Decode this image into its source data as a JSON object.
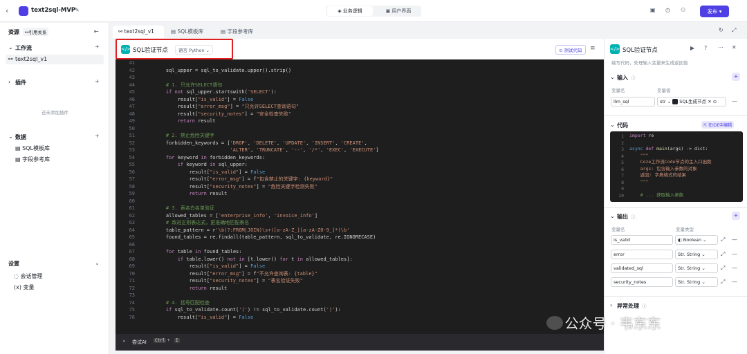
{
  "header": {
    "back_icon": "chevron-left",
    "project_title": "text2sql-MVP",
    "mode_tabs": [
      "业务逻辑",
      "用户界面"
    ],
    "publish_label": "发布"
  },
  "sidebar": {
    "resources_label": "资源",
    "references_label": "引用关系",
    "workflow_label": "工作流",
    "workflow_items": [
      "text2sql_v1"
    ],
    "plugins_label": "插件",
    "plugins_empty": "还未添加插件",
    "data_label": "数据",
    "data_items": [
      "SQL模板库",
      "字段参考库"
    ],
    "settings_label": "设置",
    "settings_items": [
      "会话管理",
      "变量"
    ]
  },
  "tabs": [
    "text2sql_v1",
    "SQL模板库",
    "字段参考库"
  ],
  "editor": {
    "title": "SQL验证节点",
    "language": "语言 Python",
    "test_label": "测试代码",
    "line_start": 41,
    "lines": [
      [],
      [
        [
          "v",
          "    sql_upper = sql_to_validate.upper().strip()"
        ]
      ],
      [],
      [
        [
          "cm",
          "    # 1. 只允许SELECT语句"
        ]
      ],
      [
        [
          "kw",
          "    if not "
        ],
        [
          "v",
          "sql_upper.startswith("
        ],
        [
          "str",
          "'SELECT'"
        ],
        [
          "v",
          "):"
        ]
      ],
      [
        [
          "v",
          "        result["
        ],
        [
          "str",
          "\"is_valid\""
        ],
        [
          "v",
          "] = "
        ],
        [
          "kw2",
          "False"
        ]
      ],
      [
        [
          "v",
          "        result["
        ],
        [
          "str",
          "\"error_msg\""
        ],
        [
          "v",
          "] = "
        ],
        [
          "str",
          "\"只允许SELECT查询语句\""
        ]
      ],
      [
        [
          "v",
          "        result["
        ],
        [
          "str",
          "\"security_notes\""
        ],
        [
          "v",
          "] = "
        ],
        [
          "str",
          "\"安全检查失败\""
        ]
      ],
      [
        [
          "kw",
          "        return "
        ],
        [
          "v",
          "result"
        ]
      ],
      [],
      [
        [
          "cm",
          "    # 2. 禁止危险关键字"
        ]
      ],
      [
        [
          "v",
          "    forbidden_keywords = ["
        ],
        [
          "str",
          "'DROP'"
        ],
        [
          "v",
          ", "
        ],
        [
          "str",
          "'DELETE'"
        ],
        [
          "v",
          ", "
        ],
        [
          "str",
          "'UPDATE'"
        ],
        [
          "v",
          ", "
        ],
        [
          "str",
          "'INSERT'"
        ],
        [
          "v",
          ", "
        ],
        [
          "str",
          "'CREATE'"
        ],
        [
          "v",
          ","
        ]
      ],
      [
        [
          "v",
          "                          "
        ],
        [
          "str",
          "'ALTER'"
        ],
        [
          "v",
          ", "
        ],
        [
          "str",
          "'TRUNCATE'"
        ],
        [
          "v",
          ", "
        ],
        [
          "str",
          "'--'"
        ],
        [
          "v",
          ", "
        ],
        [
          "str",
          "'/*'"
        ],
        [
          "v",
          ", "
        ],
        [
          "str",
          "'EXEC'"
        ],
        [
          "v",
          ", "
        ],
        [
          "str",
          "'EXECUTE'"
        ],
        [
          "v",
          "]"
        ]
      ],
      [
        [
          "kw",
          "    for "
        ],
        [
          "v",
          "keyword "
        ],
        [
          "kw",
          "in "
        ],
        [
          "v",
          "forbidden_keywords:"
        ]
      ],
      [
        [
          "kw",
          "        if "
        ],
        [
          "v",
          "keyword "
        ],
        [
          "kw",
          "in "
        ],
        [
          "v",
          "sql_upper:"
        ]
      ],
      [
        [
          "v",
          "            result["
        ],
        [
          "str",
          "\"is_valid\""
        ],
        [
          "v",
          "] = "
        ],
        [
          "kw2",
          "False"
        ]
      ],
      [
        [
          "v",
          "            result["
        ],
        [
          "str",
          "\"error_msg\""
        ],
        [
          "v",
          "] = f"
        ],
        [
          "str",
          "\"包含禁止的关键字: {keyword}\""
        ]
      ],
      [
        [
          "v",
          "            result["
        ],
        [
          "str",
          "\"security_notes\""
        ],
        [
          "v",
          "] = "
        ],
        [
          "str",
          "\"危险关键字检测失败\""
        ]
      ],
      [
        [
          "kw",
          "            return "
        ],
        [
          "v",
          "result"
        ]
      ],
      [],
      [
        [
          "cm",
          "    # 3. 表名白名单验证"
        ]
      ],
      [
        [
          "v",
          "    allowed_tables = ["
        ],
        [
          "str",
          "'enterprise_info'"
        ],
        [
          "v",
          ", "
        ],
        [
          "str",
          "'invoice_info'"
        ],
        [
          "v",
          "]"
        ]
      ],
      [
        [
          "cm",
          "    # 改进正则表达式，更准确地匹配表名"
        ]
      ],
      [
        [
          "v",
          "    table_pattern = r"
        ],
        [
          "str",
          "'\\b(?:FROM|JOIN)\\s+([a-zA-Z_][a-zA-Z0-9_]*)\\b'"
        ]
      ],
      [
        [
          "v",
          "    found_tables = re.findall(table_pattern, sql_to_validate, re.IGNORECASE)"
        ]
      ],
      [],
      [
        [
          "kw",
          "    for "
        ],
        [
          "v",
          "table "
        ],
        [
          "kw",
          "in "
        ],
        [
          "v",
          "found_tables:"
        ]
      ],
      [
        [
          "kw",
          "        if "
        ],
        [
          "v",
          "table.lower() "
        ],
        [
          "kw",
          "not in "
        ],
        [
          "v",
          "[t.lower() "
        ],
        [
          "kw",
          "for "
        ],
        [
          "v",
          "t "
        ],
        [
          "kw",
          "in "
        ],
        [
          "v",
          "allowed_tables]:"
        ]
      ],
      [
        [
          "v",
          "            result["
        ],
        [
          "str",
          "\"is_valid\""
        ],
        [
          "v",
          "] = "
        ],
        [
          "kw2",
          "False"
        ]
      ],
      [
        [
          "v",
          "            result["
        ],
        [
          "str",
          "\"error_msg\""
        ],
        [
          "v",
          "] = f"
        ],
        [
          "str",
          "\"不允许查询表: {table}\""
        ]
      ],
      [
        [
          "v",
          "            result["
        ],
        [
          "str",
          "\"security_notes\""
        ],
        [
          "v",
          "] = "
        ],
        [
          "str",
          "\"表名验证失败\""
        ]
      ],
      [
        [
          "kw",
          "            return "
        ],
        [
          "v",
          "result"
        ]
      ],
      [],
      [
        [
          "cm",
          "    # 4. 括号匹配检查"
        ]
      ],
      [
        [
          "kw",
          "    if "
        ],
        [
          "v",
          "sql_to_validate.count("
        ],
        [
          "str",
          "'('"
        ],
        [
          "v",
          ") != sql_to_validate.count("
        ],
        [
          "str",
          "')'"
        ],
        [
          "v",
          "):"
        ]
      ],
      [
        [
          "v",
          "        result["
        ],
        [
          "str",
          "\"is_valid\""
        ],
        [
          "v",
          "] = "
        ],
        [
          "kw2",
          "False"
        ]
      ]
    ],
    "ai_label": "尝试AI",
    "ai_shortcut": [
      "Ctrl",
      "+",
      "I"
    ]
  },
  "panel": {
    "title": "SQL验证节点",
    "desc": "编写代码，处理输入变量来生成返回值",
    "input_label": "输入",
    "input_col_name": "变量名",
    "input_col_value": "变量值",
    "input_var": "llm_sql",
    "input_type": "str",
    "input_ref": "SQL生成节点",
    "code_label": "代码",
    "ide_label": "在IDE中编辑",
    "code_lines": [
      [
        [
          "kw",
          "import "
        ],
        [
          "v",
          "re"
        ]
      ],
      [],
      [
        [
          "kw2",
          "async "
        ],
        [
          "kw",
          "def "
        ],
        [
          "fn",
          "main"
        ],
        [
          "v",
          "(args) -> dict:"
        ]
      ],
      [
        [
          "str",
          "    \"\"\""
        ]
      ],
      [
        [
          "str",
          "    Coze工作流Code节点的主入口函数"
        ]
      ],
      [
        [
          "str",
          "    args: 包含输入参数的对象"
        ]
      ],
      [
        [
          "str",
          "    返回: 字典格式的结果"
        ]
      ],
      [
        [
          "str",
          "    \"\"\""
        ]
      ],
      [],
      [
        [
          "cm",
          "    # ... 获取输入参数"
        ]
      ]
    ],
    "output_label": "输出",
    "output_col_name": "变量名",
    "output_col_type": "变量类型",
    "outputs": [
      {
        "name": "is_valid",
        "type": "Boolean"
      },
      {
        "name": "error",
        "type": "String"
      },
      {
        "name": "validated_sql",
        "type": "String"
      },
      {
        "name": "security_notes",
        "type": "String"
      }
    ],
    "exception_label": "异常处理"
  },
  "watermark": "公众号 · 韦东东",
  "colors": {
    "accent": "#4e40e5",
    "highlight": "#e02020",
    "code_bg": "#1e1e1e"
  }
}
